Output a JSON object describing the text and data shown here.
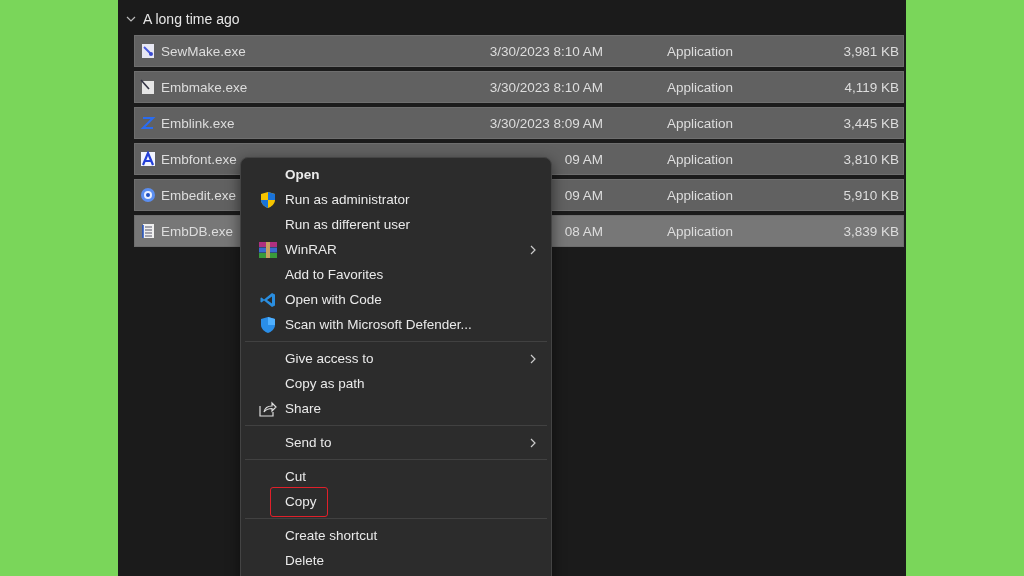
{
  "group": {
    "title": "A long time ago",
    "expanded": true
  },
  "files": [
    {
      "name": "SewMake.exe",
      "kind": "sewmake",
      "date": "3/30/2023 8:10 AM",
      "type": "Application",
      "size": "3,981 KB",
      "selected": true,
      "hovered": false
    },
    {
      "name": "Embmake.exe",
      "kind": "embmake",
      "date": "3/30/2023 8:10 AM",
      "type": "Application",
      "size": "4,119 KB",
      "selected": true,
      "hovered": false
    },
    {
      "name": "Emblink.exe",
      "kind": "emblink",
      "date": "3/30/2023 8:09 AM",
      "type": "Application",
      "size": "3,445 KB",
      "selected": true,
      "hovered": false
    },
    {
      "name": "Embfont.exe",
      "kind": "embfont",
      "date": "09 AM",
      "type": "Application",
      "size": "3,810 KB",
      "selected": true,
      "hovered": false
    },
    {
      "name": "Embedit.exe",
      "kind": "embedit",
      "date": "09 AM",
      "type": "Application",
      "size": "5,910 KB",
      "selected": true,
      "hovered": false
    },
    {
      "name": "EmbDB.exe",
      "kind": "embdb",
      "date": "08 AM",
      "type": "Application",
      "size": "3,839 KB",
      "selected": true,
      "hovered": true
    }
  ],
  "context_menu": {
    "sections": [
      [
        {
          "label": "Open",
          "kind": "plain",
          "bold": true,
          "submenu": false,
          "highlighted": false
        },
        {
          "label": "Run as administrator",
          "kind": "shield",
          "bold": false,
          "submenu": false,
          "highlighted": false
        },
        {
          "label": "Run as different user",
          "kind": "plain",
          "bold": false,
          "submenu": false,
          "highlighted": false
        },
        {
          "label": "WinRAR",
          "kind": "winrar",
          "bold": false,
          "submenu": true,
          "highlighted": false
        },
        {
          "label": "Add to Favorites",
          "kind": "plain",
          "bold": false,
          "submenu": false,
          "highlighted": false
        },
        {
          "label": "Open with Code",
          "kind": "code",
          "bold": false,
          "submenu": false,
          "highlighted": false
        },
        {
          "label": "Scan with Microsoft Defender...",
          "kind": "defender",
          "bold": false,
          "submenu": false,
          "highlighted": false
        }
      ],
      [
        {
          "label": "Give access to",
          "kind": "plain",
          "bold": false,
          "submenu": true,
          "highlighted": false
        },
        {
          "label": "Copy as path",
          "kind": "plain",
          "bold": false,
          "submenu": false,
          "highlighted": false
        },
        {
          "label": "Share",
          "kind": "share",
          "bold": false,
          "submenu": false,
          "highlighted": false
        }
      ],
      [
        {
          "label": "Send to",
          "kind": "plain",
          "bold": false,
          "submenu": true,
          "highlighted": false
        }
      ],
      [
        {
          "label": "Cut",
          "kind": "plain",
          "bold": false,
          "submenu": false,
          "highlighted": false
        },
        {
          "label": "Copy",
          "kind": "plain",
          "bold": false,
          "submenu": false,
          "highlighted": true
        }
      ],
      [
        {
          "label": "Create shortcut",
          "kind": "plain",
          "bold": false,
          "submenu": false,
          "highlighted": false
        },
        {
          "label": "Delete",
          "kind": "plain",
          "bold": false,
          "submenu": false,
          "highlighted": false
        }
      ]
    ]
  }
}
